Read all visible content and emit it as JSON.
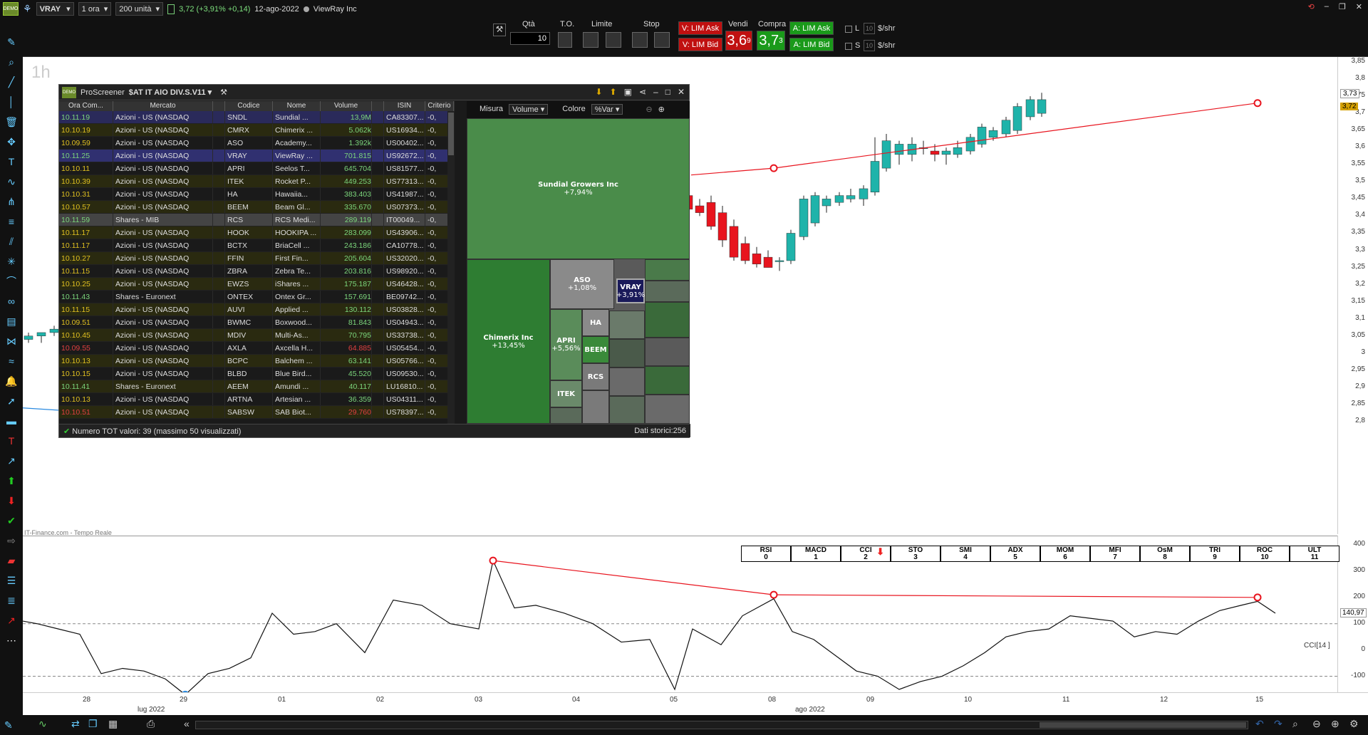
{
  "topbar": {
    "symbol": "VRAY",
    "interval": "1 ora",
    "units": "200 unità",
    "quote": "3,72 (+3,91% +0,14)",
    "date": "12-ago-2022",
    "name": "ViewRay Inc"
  },
  "order": {
    "qty_label": "Qtà",
    "qty_value": "10",
    "to_label": "T.O.",
    "limit_label": "Limite",
    "stop_label": "Stop",
    "v_lim_ask": "V: LIM Ask",
    "v_lim_bid": "V: LIM Bid",
    "vendi_label": "Vendi",
    "compra_label": "Compra",
    "bid": "3,6",
    "bid_sup": "9",
    "ask": "3,7",
    "ask_sup": "3",
    "a_lim_ask": "A: LIM Ask",
    "a_lim_bid": "A: LIM Bid",
    "l_label": "L",
    "s_label": "S",
    "l_val": "10",
    "s_val": "10",
    "shr1": "$/shr",
    "shr2": "$/shr"
  },
  "chart": {
    "timeframe": "1h",
    "source": "IT-Finance.com - Tempo Reale",
    "price_ticks": [
      "3,85",
      "3,8",
      "3,75",
      "3,7",
      "3,65",
      "3,6",
      "3,55",
      "3,5",
      "3,45",
      "3,4",
      "3,35",
      "3,3",
      "3,25",
      "3,2",
      "3,15",
      "3,1",
      "3,05",
      "3",
      "2,95",
      "2,9",
      "2,85",
      "2,8"
    ],
    "last_price": "3,72",
    "last_price2": "3,73",
    "osc_ticks": [
      "400",
      "300",
      "200",
      "100",
      "0",
      "-100"
    ],
    "osc_label": "CCI[14 ]",
    "osc_value": "140,97",
    "time_labels": [
      "28",
      "29",
      "01",
      "02",
      "03",
      "04",
      "05",
      "08",
      "09",
      "10",
      "11",
      "12",
      "15"
    ],
    "month_labels": [
      "lug 2022",
      "ago 2022"
    ],
    "indicators": [
      {
        "name": "RSI",
        "n": "0"
      },
      {
        "name": "MACD",
        "n": "1"
      },
      {
        "name": "CCI",
        "n": "2"
      },
      {
        "name": "STO",
        "n": "3"
      },
      {
        "name": "SMI",
        "n": "4"
      },
      {
        "name": "ADX",
        "n": "5"
      },
      {
        "name": "MOM",
        "n": "6"
      },
      {
        "name": "MFI",
        "n": "7"
      },
      {
        "name": "OsM",
        "n": "8"
      },
      {
        "name": "TRI",
        "n": "9"
      },
      {
        "name": "ROC",
        "n": "10"
      },
      {
        "name": "ULT",
        "n": "11"
      }
    ]
  },
  "screener": {
    "title": "ProScreener",
    "list": "$AT IT AIO DIV.S.V11",
    "columns": [
      "Ora Com...",
      "Mercato",
      "Codice",
      "Nome",
      "Volume",
      "ISIN",
      "Criterio"
    ],
    "rows": [
      {
        "time": "10.11.19",
        "market": "Azioni - US (NASDAQ",
        "code": "SNDL",
        "name": "Sundial ...",
        "vol": "13,9M",
        "isin": "CA83307...",
        "crit": "-0,",
        "tc": "#7cd67c",
        "vc": "#7cd67c",
        "bg": "#2a2a5a"
      },
      {
        "time": "10.10.19",
        "market": "Azioni - US (NASDAQ",
        "code": "CMRX",
        "name": "Chimerix ...",
        "vol": "5.062k",
        "isin": "US16934...",
        "crit": "-0,",
        "tc": "#e0c020",
        "vc": "#7cd67c",
        "bg": "#2a2a10"
      },
      {
        "time": "10.09.59",
        "market": "Azioni - US (NASDAQ",
        "code": "ASO",
        "name": "Academy...",
        "vol": "1.392k",
        "isin": "US00402...",
        "crit": "-0,",
        "tc": "#e0c020",
        "vc": "#7cd67c",
        "bg": "#1a1a1a"
      },
      {
        "time": "10.11.25",
        "market": "Azioni - US (NASDAQ",
        "code": "VRAY",
        "name": "ViewRay ...",
        "vol": "701.815",
        "isin": "US92672...",
        "crit": "-0,",
        "tc": "#7cd67c",
        "vc": "#7cd67c",
        "bg": "#303070"
      },
      {
        "time": "10.10.11",
        "market": "Azioni - US (NASDAQ",
        "code": "APRI",
        "name": "Seelos T...",
        "vol": "645.704",
        "isin": "US81577...",
        "crit": "-0,",
        "tc": "#e0c020",
        "vc": "#7cd67c",
        "bg": "#1a1a1a"
      },
      {
        "time": "10.10.39",
        "market": "Azioni - US (NASDAQ",
        "code": "ITEK",
        "name": "Rocket P...",
        "vol": "449.253",
        "isin": "US77313...",
        "crit": "-0,",
        "tc": "#e0c020",
        "vc": "#7cd67c",
        "bg": "#2a2a10"
      },
      {
        "time": "10.10.31",
        "market": "Azioni - US (NASDAQ",
        "code": "HA",
        "name": "Hawaiia...",
        "vol": "383.403",
        "isin": "US41987...",
        "crit": "-0,",
        "tc": "#e0c020",
        "vc": "#7cd67c",
        "bg": "#1a1a1a"
      },
      {
        "time": "10.10.57",
        "market": "Azioni - US (NASDAQ",
        "code": "BEEM",
        "name": "Beam Gl...",
        "vol": "335.670",
        "isin": "US07373...",
        "crit": "-0,",
        "tc": "#e0c020",
        "vc": "#7cd67c",
        "bg": "#2a2a10"
      },
      {
        "time": "10.11.59",
        "market": "Shares - MIB",
        "code": "RCS",
        "name": "RCS Medi...",
        "vol": "289.119",
        "isin": "IT00049...",
        "crit": "-0,",
        "tc": "#7cd67c",
        "vc": "#7cd67c",
        "bg": "#444"
      },
      {
        "time": "10.11.17",
        "market": "Azioni - US (NASDAQ",
        "code": "HOOK",
        "name": "HOOKIPA ...",
        "vol": "283.099",
        "isin": "US43906...",
        "crit": "-0,",
        "tc": "#e0c020",
        "vc": "#7cd67c",
        "bg": "#2a2a10"
      },
      {
        "time": "10.11.17",
        "market": "Azioni - US (NASDAQ",
        "code": "BCTX",
        "name": "BriaCell ...",
        "vol": "243.186",
        "isin": "CA10778...",
        "crit": "-0,",
        "tc": "#e0c020",
        "vc": "#7cd67c",
        "bg": "#1a1a1a"
      },
      {
        "time": "10.10.27",
        "market": "Azioni - US (NASDAQ",
        "code": "FFIN",
        "name": "First Fin...",
        "vol": "205.604",
        "isin": "US32020...",
        "crit": "-0,",
        "tc": "#e0c020",
        "vc": "#7cd67c",
        "bg": "#2a2a10"
      },
      {
        "time": "10.11.15",
        "market": "Azioni - US (NASDAQ",
        "code": "ZBRA",
        "name": "Zebra Te...",
        "vol": "203.816",
        "isin": "US98920...",
        "crit": "-0,",
        "tc": "#e0c020",
        "vc": "#7cd67c",
        "bg": "#1a1a1a"
      },
      {
        "time": "10.10.25",
        "market": "Azioni - US (NASDAQ",
        "code": "EWZS",
        "name": "iShares ...",
        "vol": "175.187",
        "isin": "US46428...",
        "crit": "-0,",
        "tc": "#e0c020",
        "vc": "#7cd67c",
        "bg": "#2a2a10"
      },
      {
        "time": "10.11.43",
        "market": "Shares - Euronext",
        "code": "ONTEX",
        "name": "Ontex Gr...",
        "vol": "157.691",
        "isin": "BE09742...",
        "crit": "-0,",
        "tc": "#7cd67c",
        "vc": "#7cd67c",
        "bg": "#1a1a1a"
      },
      {
        "time": "10.11.15",
        "market": "Azioni - US (NASDAQ",
        "code": "AUVI",
        "name": "Applied ...",
        "vol": "130.112",
        "isin": "US03828...",
        "crit": "-0,",
        "tc": "#e0c020",
        "vc": "#7cd67c",
        "bg": "#2a2a10"
      },
      {
        "time": "10.09.51",
        "market": "Azioni - US (NASDAQ",
        "code": "BWMC",
        "name": "Boxwood...",
        "vol": "81.843",
        "isin": "US04943...",
        "crit": "-0,",
        "tc": "#e0c020",
        "vc": "#7cd67c",
        "bg": "#1a1a1a"
      },
      {
        "time": "10.10.45",
        "market": "Azioni - US (NASDAQ",
        "code": "MDIV",
        "name": "Multi-As...",
        "vol": "70.795",
        "isin": "US33738...",
        "crit": "-0,",
        "tc": "#e0c020",
        "vc": "#7cd67c",
        "bg": "#2a2a10"
      },
      {
        "time": "10.09.55",
        "market": "Azioni - US (NASDAQ",
        "code": "AXLA",
        "name": "Axcella H...",
        "vol": "64.885",
        "isin": "US05454...",
        "crit": "-0,",
        "tc": "#e04040",
        "vc": "#e04040",
        "bg": "#1a1a1a"
      },
      {
        "time": "10.10.13",
        "market": "Azioni - US (NASDAQ",
        "code": "BCPC",
        "name": "Balchem ...",
        "vol": "63.141",
        "isin": "US05766...",
        "crit": "-0,",
        "tc": "#e0c020",
        "vc": "#7cd67c",
        "bg": "#2a2a10"
      },
      {
        "time": "10.10.15",
        "market": "Azioni - US (NASDAQ",
        "code": "BLBD",
        "name": "Blue Bird...",
        "vol": "45.520",
        "isin": "US09530...",
        "crit": "-0,",
        "tc": "#e0c020",
        "vc": "#7cd67c",
        "bg": "#1a1a1a"
      },
      {
        "time": "10.11.41",
        "market": "Shares - Euronext",
        "code": "AEEM",
        "name": "Amundi ...",
        "vol": "40.117",
        "isin": "LU16810...",
        "crit": "-0,",
        "tc": "#7cd67c",
        "vc": "#7cd67c",
        "bg": "#2a2a10"
      },
      {
        "time": "10.10.13",
        "market": "Azioni - US (NASDAQ",
        "code": "ARTNA",
        "name": "Artesian ...",
        "vol": "36.359",
        "isin": "US04311...",
        "crit": "-0,",
        "tc": "#e0c020",
        "vc": "#7cd67c",
        "bg": "#1a1a1a"
      },
      {
        "time": "10.10.51",
        "market": "Azioni - US (NASDAQ",
        "code": "SABSW",
        "name": "SAB Biot...",
        "vol": "29.760",
        "isin": "US78397...",
        "crit": "-0,",
        "tc": "#e04040",
        "vc": "#e04040",
        "bg": "#2a2a10"
      }
    ],
    "measure_label": "Misura",
    "measure_value": "Volume",
    "color_label": "Colore",
    "color_value": "%Var",
    "status_left": "Numero TOT valori: 39 (massimo 50 visualizzati)",
    "status_right": "Dati storici:256",
    "tiles": [
      {
        "name": "Sundial Growers Inc",
        "pct": "+7,94%"
      },
      {
        "name": "Chimerix Inc",
        "pct": "+13,45%"
      },
      {
        "name": "ASO",
        "pct": "+1,08%"
      },
      {
        "name": "VRAY",
        "pct": "+3,91%"
      },
      {
        "name": "APRI",
        "pct": "+5,56%"
      },
      {
        "name": "HA",
        "pct": ""
      },
      {
        "name": "BEEM",
        "pct": ""
      },
      {
        "name": "ITEK",
        "pct": ""
      },
      {
        "name": "RCS",
        "pct": ""
      }
    ]
  },
  "colors": {
    "up": "#1fb3aa",
    "down": "#e8141e",
    "accent": "#d4a000"
  }
}
